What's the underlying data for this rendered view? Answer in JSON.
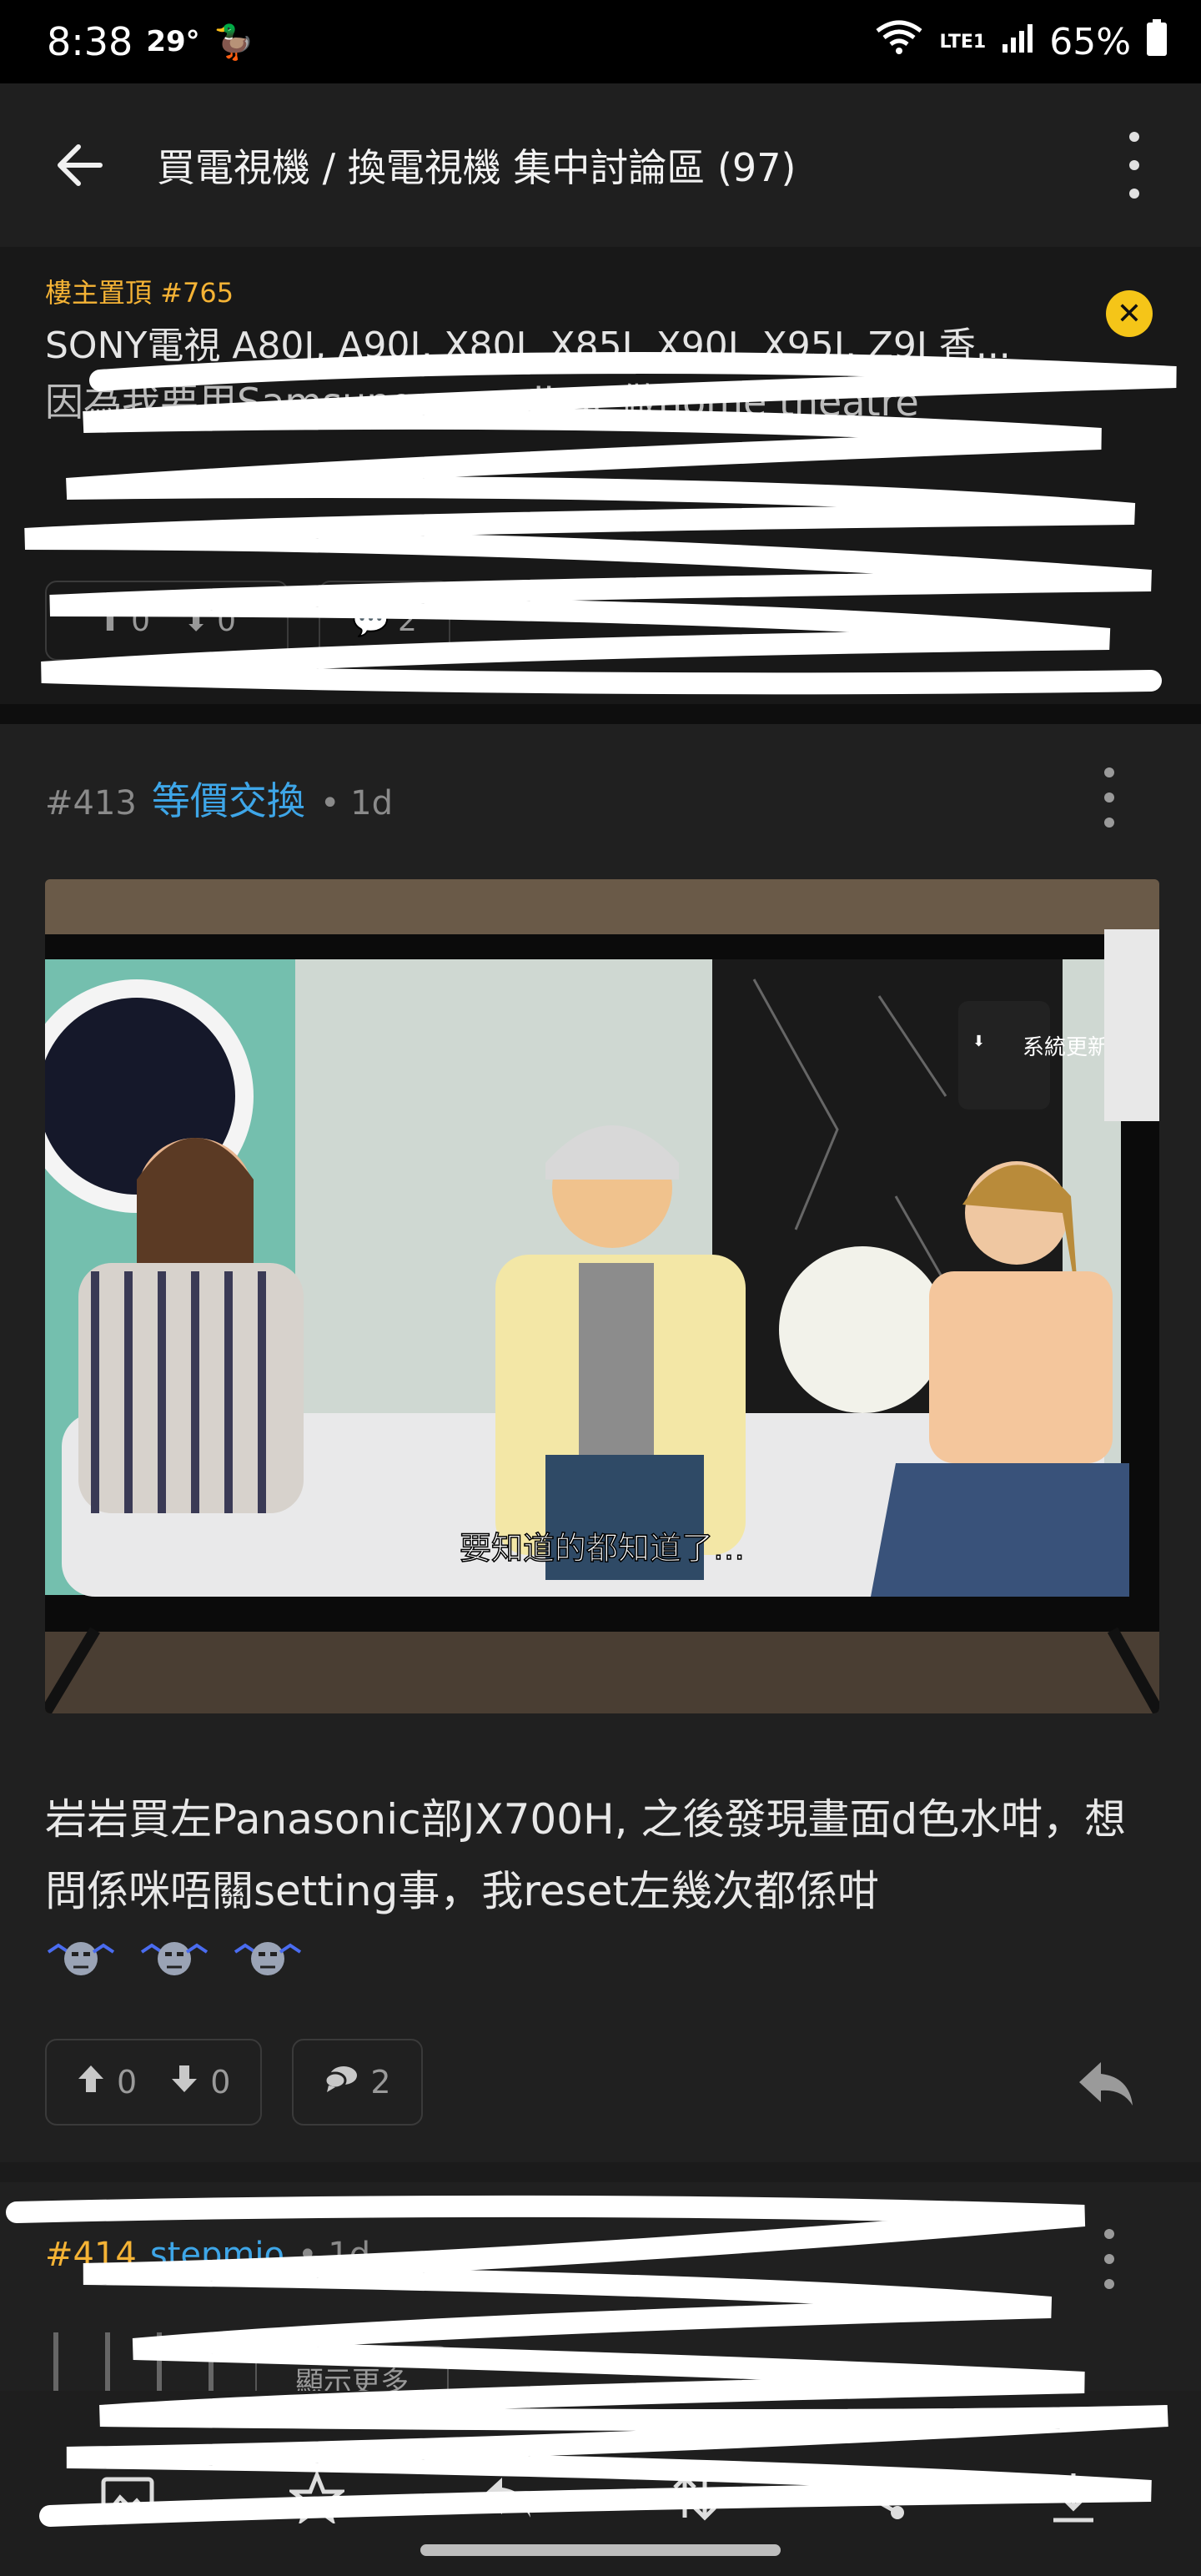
{
  "status_bar": {
    "time": "8:38",
    "temperature": "29°",
    "network": "LTE1",
    "battery": "65%"
  },
  "header": {
    "title": "買電視機 / 換電視機 集中討論區 (97)"
  },
  "pinned": {
    "label": "樓主置頂 #765",
    "title": "SONY電視 A80J, A90J, X80J, X85J, X90J, X95J, Z9J 香...",
    "body_partial": "因為我要用Samsung soundbar 做home theatre",
    "upvotes": "0",
    "downvotes": "0",
    "comments": "2"
  },
  "post": {
    "floor": "#413",
    "user": "等價交換",
    "time": "• 1d",
    "image_caption": "要知道的都知道了…",
    "image_overlay": "系統更新",
    "content": "岩岩買左Panasonic部JX700H, 之後發現畫面d色水咁，想問係咪唔關setting事，我reset左幾次都係咁",
    "upvotes": "0",
    "downvotes": "0",
    "comments": "2"
  },
  "post2": {
    "floor": "#414",
    "user": "stepmio",
    "time": "• 1d",
    "show_more": "顯示更多"
  },
  "colors": {
    "accent_yellow": "#f5b335",
    "link_blue": "#3ea6e8",
    "background": "#1b1b1b"
  },
  "bottom_bar": {
    "icons": [
      "image-icon",
      "star-icon",
      "reply-icon",
      "sort-icon",
      "share-icon",
      "download-icon"
    ]
  }
}
